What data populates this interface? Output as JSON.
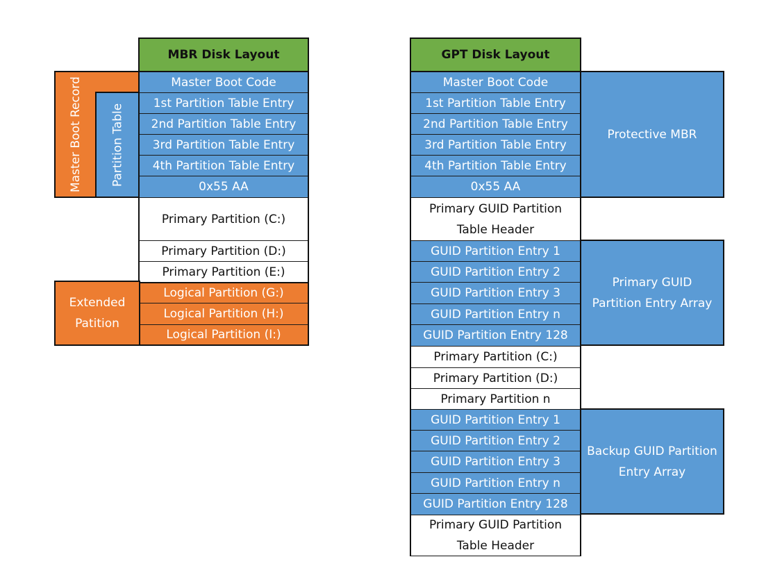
{
  "colors": {
    "header_green": "#70ad47",
    "structure_blue": "#5b9bd5",
    "extended_orange": "#ed7d31",
    "partition_white": "#ffffff"
  },
  "mbr": {
    "title": "MBR Disk Layout",
    "rows": [
      "Master Boot Code",
      "1st Partition Table Entry",
      "2nd Partition Table Entry",
      "3rd Partition Table Entry",
      "4th Partition Table Entry",
      "0x55 AA",
      "Primary Partition (C:)",
      "Primary Partition (D:)",
      "Primary Partition (E:)",
      "Logical Partition (G:)",
      "Logical Partition (H:)",
      "Logical Partition (I:)"
    ],
    "groups": {
      "master_boot_record": "Master Boot Record",
      "partition_table": "Partition Table",
      "extended_partition": "Extended Patition"
    }
  },
  "gpt": {
    "title": "GPT Disk Layout",
    "rows": [
      "Master Boot Code",
      "1st Partition Table Entry",
      "2nd Partition Table Entry",
      "3rd Partition Table Entry",
      "4th Partition Table Entry",
      "0x55 AA",
      "Primary GUID Partition Table Header",
      "GUID Partition Entry 1",
      "GUID Partition Entry 2",
      "GUID Partition Entry 3",
      "GUID Partition Entry n",
      "GUID Partition Entry 128",
      "Primary Partition (C:)",
      "Primary Partition (D:)",
      "Primary Partition n",
      "GUID Partition Entry 1",
      "GUID Partition Entry 2",
      "GUID Partition Entry 3",
      "GUID Partition Entry n",
      "GUID Partition Entry 128",
      "Primary GUID Partition Table Header"
    ],
    "groups": {
      "protective_mbr": "Protective MBR",
      "primary_array": "Primary GUID Partition Entry Array",
      "backup_array": "Backup GUID Partition Entry Array"
    }
  }
}
